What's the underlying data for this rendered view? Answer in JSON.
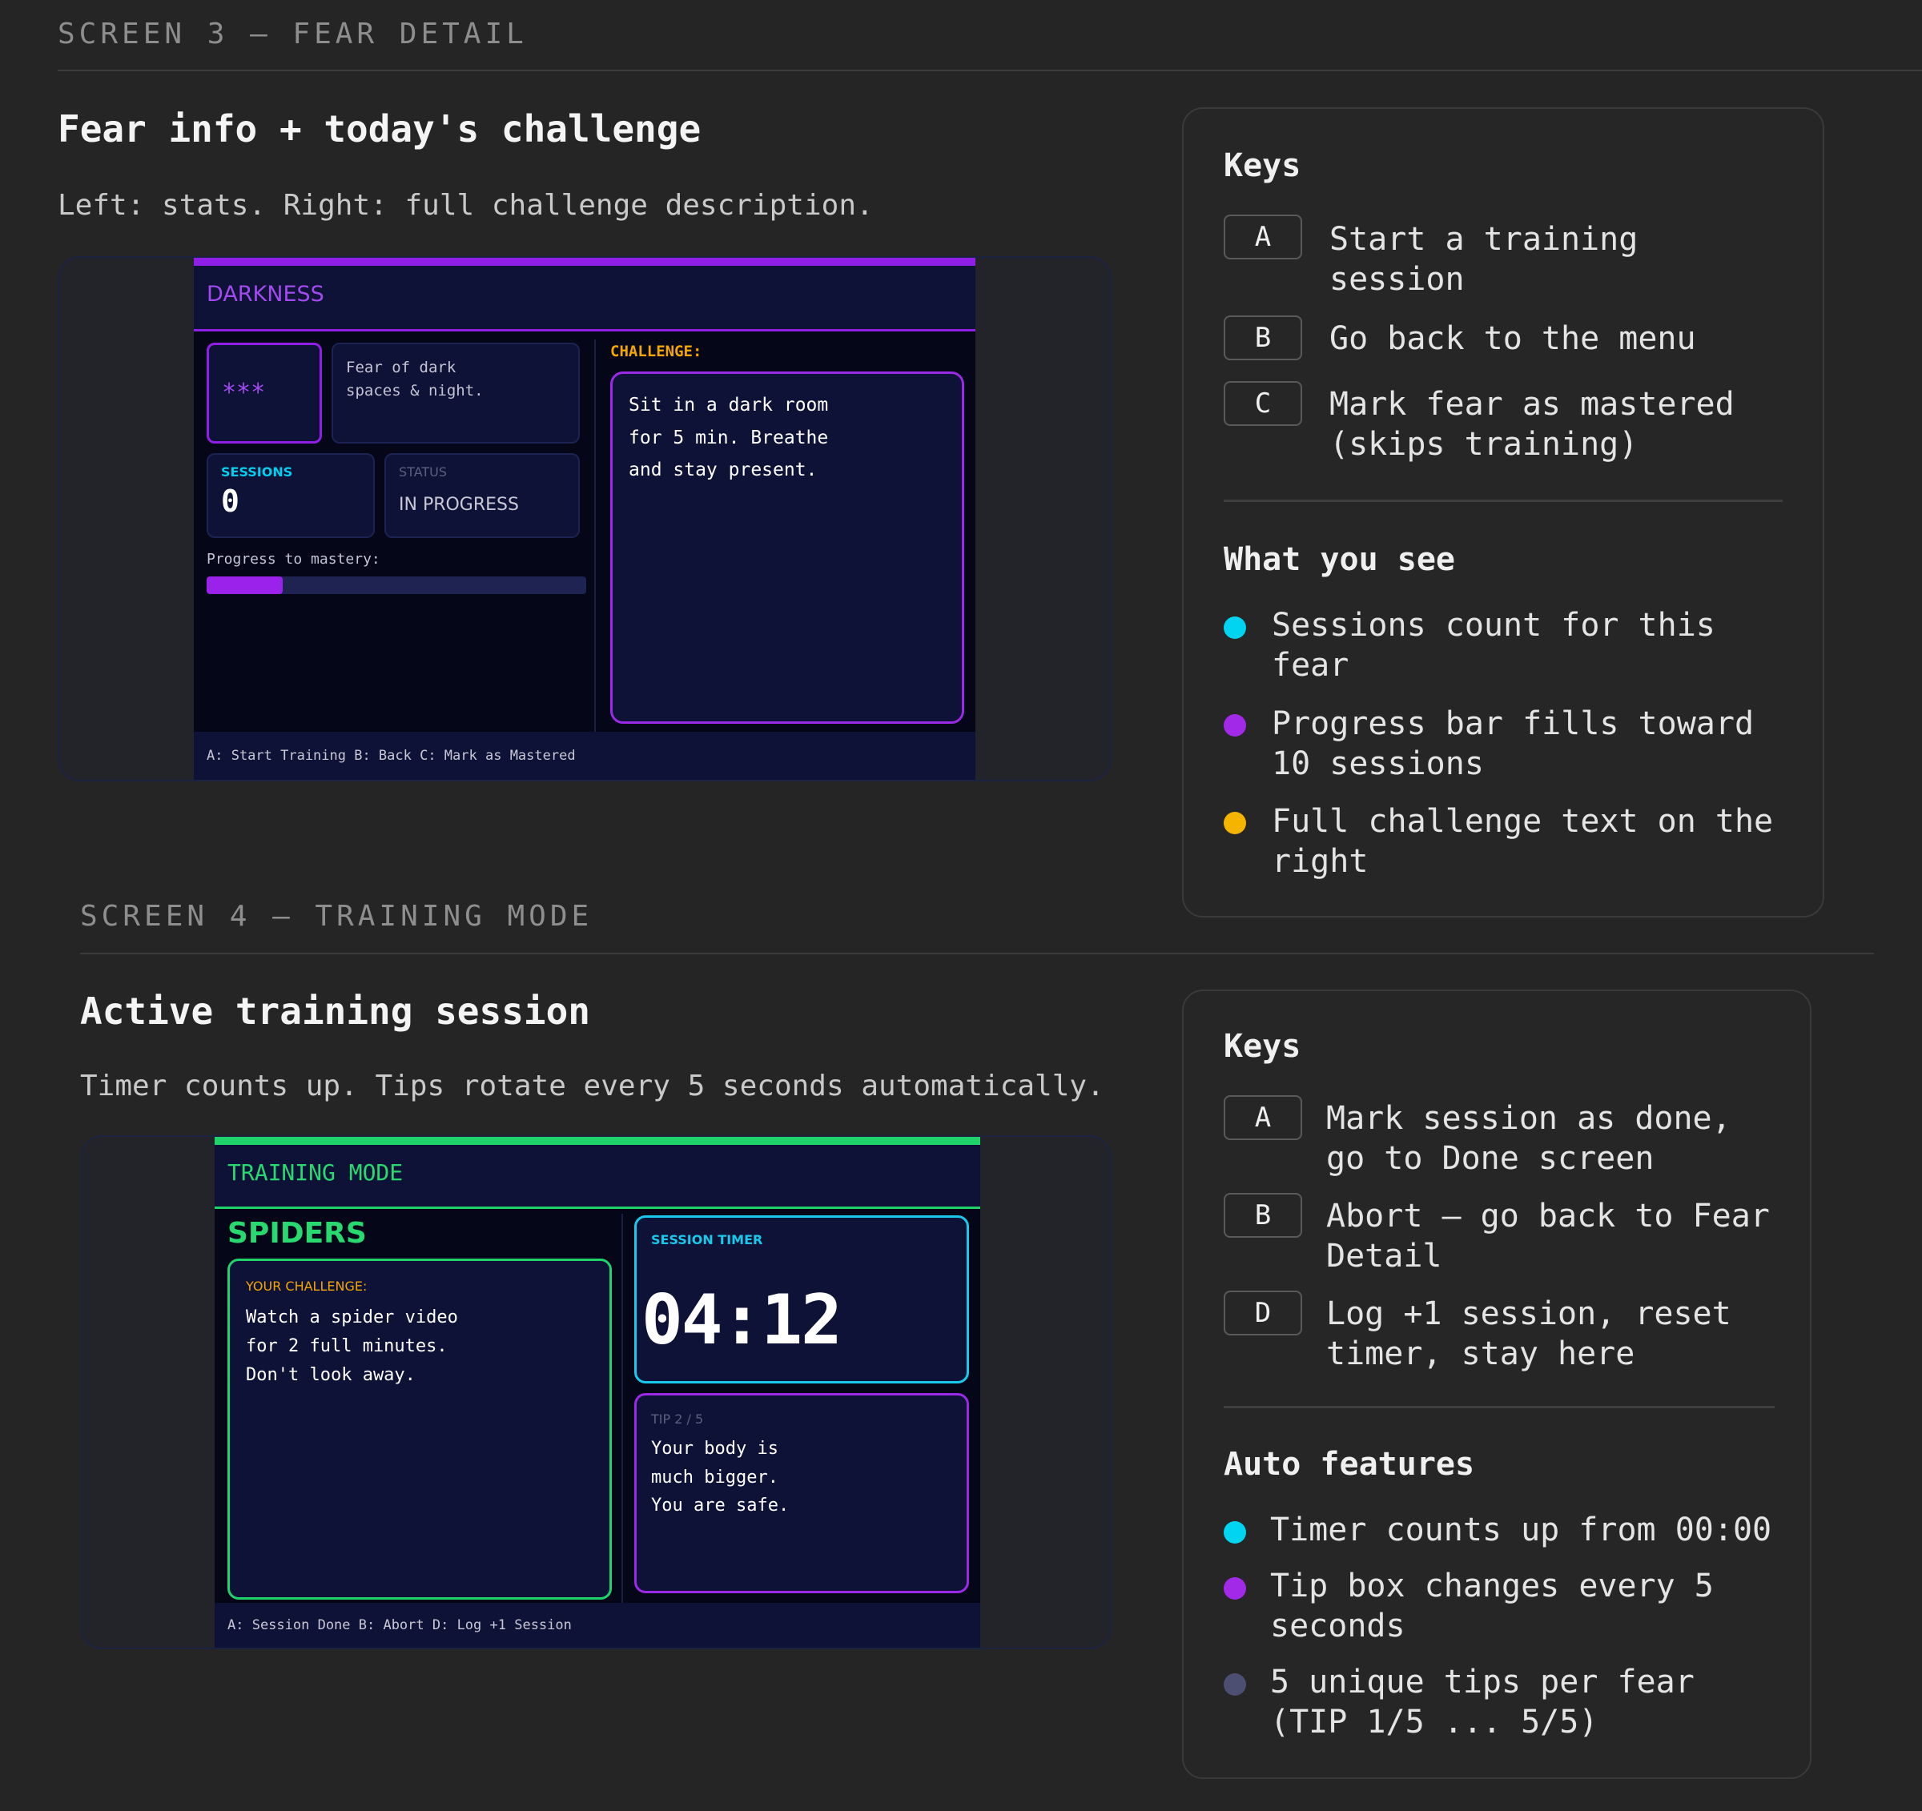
{
  "screen3": {
    "section_label": "SCREEN 3 — FEAR DETAIL",
    "title": "Fear info + today's challenge",
    "description": "Left: stats. Right: full challenge description.",
    "preview": {
      "header": "DARKNESS",
      "stars": "***",
      "fear_desc_line1": "Fear of dark",
      "fear_desc_line2": "spaces & night.",
      "sessions_label": "SESSIONS",
      "sessions_value": "0",
      "status_label": "STATUS",
      "status_value": "IN PROGRESS",
      "progress_label": "Progress to mastery:",
      "progress_fraction": 0.2,
      "challenge_label": "CHALLENGE:",
      "challenge_line1": "Sit in a dark room",
      "challenge_line2": "for 5 min. Breathe",
      "challenge_line3": "and stay present.",
      "footer": "A: Start Training B: Back C: Mark as Mastered",
      "accent": "#8f1fe6"
    },
    "keys_title": "Keys",
    "keys": [
      {
        "key": "A",
        "line1": "Start a training",
        "line2": "session"
      },
      {
        "key": "B",
        "line1": "Go back to the menu",
        "line2": ""
      },
      {
        "key": "C",
        "line1": "Mark fear as mastered",
        "line2": "(skips training)"
      }
    ],
    "see_title": "What you see",
    "bullets": [
      {
        "line1": "Sessions count for this",
        "line2": "fear",
        "color": "#00d4f0"
      },
      {
        "line1": "Progress bar fills toward",
        "line2": "10 sessions",
        "color": "#a329e8"
      },
      {
        "line1": "Full challenge text on the",
        "line2": "right",
        "color": "#f5b400"
      }
    ]
  },
  "screen4": {
    "section_label": "SCREEN 4 — TRAINING MODE",
    "title": "Active training session",
    "description": "Timer counts up. Tips rotate every 5 seconds automatically.",
    "preview": {
      "header": "TRAINING MODE",
      "fear_name": "SPIDERS",
      "challenge_label": "YOUR CHALLENGE:",
      "challenge_line1": "Watch a spider video",
      "challenge_line2": "for 2 full minutes.",
      "challenge_line3": "Don't look away.",
      "timer_label": "SESSION TIMER",
      "timer_value": "04:12",
      "tip_label": "TIP 2 / 5",
      "tip_line1": "Your body is",
      "tip_line2": "much bigger.",
      "tip_line3": "You are safe.",
      "footer": "A: Session Done B: Abort D: Log +1 Session",
      "accent": "#1fd36a"
    },
    "keys_title": "Keys",
    "keys": [
      {
        "key": "A",
        "line1": "Mark session as done,",
        "line2": "go to Done screen"
      },
      {
        "key": "B",
        "line1": "Abort — go back to Fear",
        "line2": "Detail"
      },
      {
        "key": "D",
        "line1": "Log +1 session, reset",
        "line2": "timer, stay here"
      }
    ],
    "auto_title": "Auto features",
    "bullets": [
      {
        "line1": "Timer counts up from 00:00",
        "line2": "",
        "color": "#00d4f0"
      },
      {
        "line1": "Tip box changes every 5",
        "line2": "seconds",
        "color": "#a329e8"
      },
      {
        "line1": "5 unique tips per fear",
        "line2": "(TIP 1/5 ... 5/5)",
        "color": "#4c4e72"
      }
    ]
  }
}
